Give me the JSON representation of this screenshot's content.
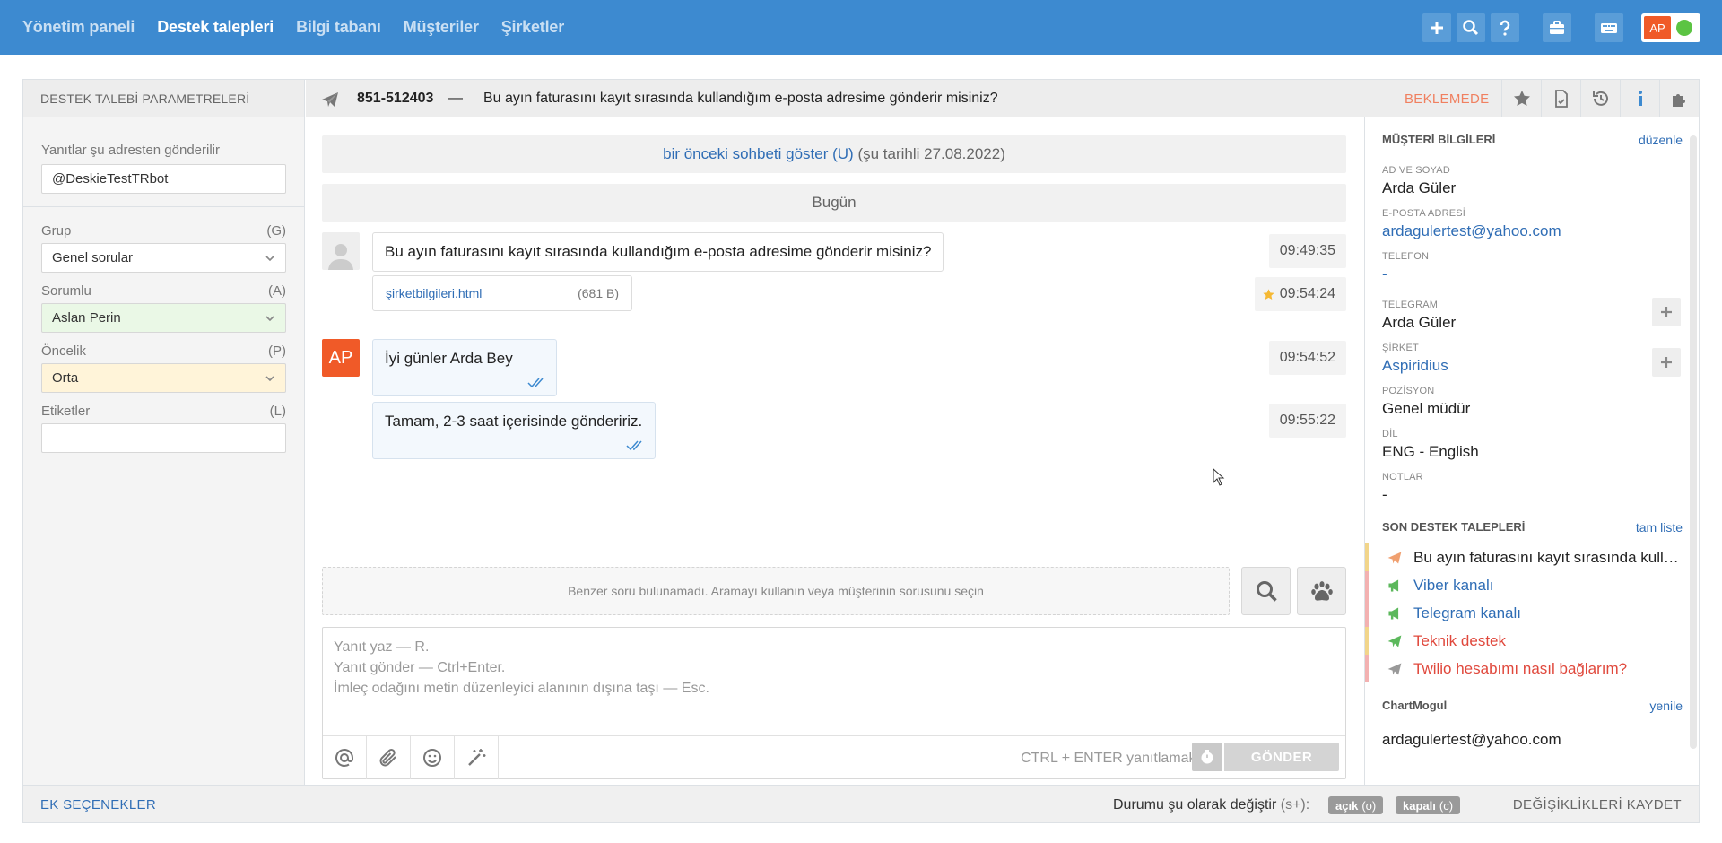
{
  "nav": {
    "items": [
      {
        "label": "Yönetim paneli",
        "active": false
      },
      {
        "label": "Destek talepleri",
        "active": true
      },
      {
        "label": "Bilgi tabanı",
        "active": false
      },
      {
        "label": "Müşteriler",
        "active": false
      },
      {
        "label": "Şirketler",
        "active": false
      }
    ],
    "user_initials": "AP",
    "online_color": "#5cc443"
  },
  "left": {
    "header": "DESTEK TALEBİ PARAMETRELERİ",
    "reply_from_label": "Yanıtlar şu adresten gönderilir",
    "reply_from_value": "@DeskieTestTRbot",
    "group_label": "Grup",
    "group_key": "(G)",
    "group_value": "Genel sorular",
    "assignee_label": "Sorumlu",
    "assignee_key": "(A)",
    "assignee_value": "Aslan Perin",
    "priority_label": "Öncelik",
    "priority_key": "(P)",
    "priority_value": "Orta",
    "tags_label": "Etiketler",
    "tags_key": "(L)",
    "tags_value": ""
  },
  "ticket": {
    "number": "851-512403",
    "dash": "—",
    "subject": "Bu ayın faturasını kayıt sırasında kullandığım e-posta adresime gönderir misiniz?",
    "status": "BEKLEMEDE"
  },
  "chat": {
    "prev_link": "bir önceki sohbeti göster (U)",
    "prev_date": "(şu tarihli 27.08.2022)",
    "today": "Bugün",
    "messages": [
      {
        "text": "Bu ayın faturasını kayıt sırasında kullandığım e-posta adresime gönderir misiniz?",
        "time": "09:49:35"
      },
      {
        "attachment": "şirketbilgileri.html",
        "size": "(681 B)",
        "time": "09:54:24"
      },
      {
        "text": "İyi günler Arda Bey",
        "time": "09:54:52",
        "avatar": "AP"
      },
      {
        "text": "Tamam, 2-3 saat içerisinde göndeririz.",
        "time": "09:55:22"
      }
    ],
    "similar": "Benzer soru bulunamadı. Aramayı kullanın veya müşterinin sorusunu seçin",
    "editor_lines": [
      "Yanıt yaz — R.",
      "Yanıt gönder — Ctrl+Enter.",
      "İmleç odağını metin düzenleyici alanının dışına taşı — Esc."
    ],
    "hint": "CTRL + ENTER yanıtlamak için",
    "send": "GÖNDER"
  },
  "customer": {
    "header": "MÜŞTERİ BİLGİLERİ",
    "edit": "düzenle",
    "name_label": "AD VE SOYAD",
    "name": "Arda Güler",
    "email_label": "E-POSTA ADRESİ",
    "email": "ardagulertest@yahoo.com",
    "phone_label": "TELEFON",
    "phone": "-",
    "telegram_label": "TELEGRAM",
    "telegram": "Arda Güler",
    "company_label": "ŞİRKET",
    "company": "Aspiridius",
    "position_label": "POZİSYON",
    "position": "Genel müdür",
    "lang_label": "DİL",
    "lang": "ENG - English",
    "notes_label": "NOTLAR",
    "notes": "-",
    "recent_header": "SON DESTEK TALEPLERİ",
    "recent_link": "tam liste",
    "recent": [
      {
        "text": "Bu ayın faturasını kayıt sırasında kullandığım e-posta adresime gönderir misiniz?",
        "color": "#222",
        "icon": "plane-icon",
        "icon_color": "#f0a070"
      },
      {
        "text": "Viber kanalı",
        "color": "#2f6db5",
        "icon": "megaphone-icon",
        "icon_color": "#5cb85c"
      },
      {
        "text": "Telegram kanalı",
        "color": "#2f6db5",
        "icon": "megaphone-icon",
        "icon_color": "#5cb85c"
      },
      {
        "text": "Teknik destek",
        "color": "#e0483c",
        "icon": "plane-icon",
        "icon_color": "#5cb85c"
      },
      {
        "text": "Twilio hesabımı nasıl bağlarım?",
        "color": "#e0483c",
        "icon": "plane-icon",
        "icon_color": "#999"
      }
    ],
    "chartmogul_header": "ChartMogul",
    "chartmogul_link": "yenile",
    "chartmogul_value": "ardagulertest@yahoo.com"
  },
  "footer": {
    "extra": "EK SEÇENEKLER",
    "change_label": "Durumu şu olarak değiştir",
    "change_key": "(s+):",
    "open": "açık",
    "open_key": "(o)",
    "closed": "kapalı",
    "closed_key": "(c)",
    "save": "DEĞİŞİKLİKLERİ KAYDET"
  }
}
